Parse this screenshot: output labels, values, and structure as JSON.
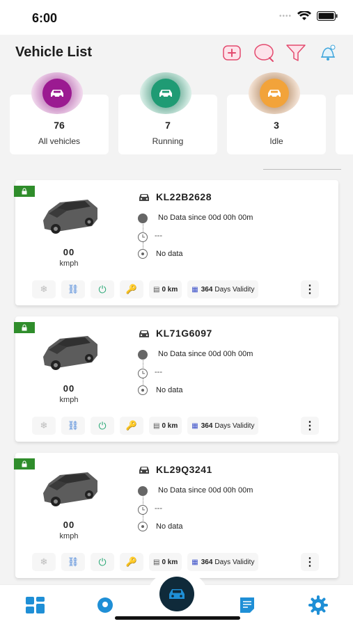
{
  "status": {
    "time": "6:00"
  },
  "header": {
    "title": "Vehicle List",
    "icons": [
      "add-icon",
      "search-icon",
      "filter-icon",
      "notification-bell-icon"
    ]
  },
  "summary": [
    {
      "count": "76",
      "label": "All vehicles",
      "color": "#9b1a91"
    },
    {
      "count": "7",
      "label": "Running",
      "color": "#1f9b74"
    },
    {
      "count": "3",
      "label": "Idle",
      "color": "#f2a33a"
    }
  ],
  "vehicles": [
    {
      "plate": "KL22B2628",
      "status_text": "No Data since  00d 00h 00m",
      "time_text": "---",
      "location_text": "No data",
      "speed": "00",
      "speed_unit": "kmph",
      "odometer": "0 km",
      "validity_days": "364",
      "validity_label": "Days Validity"
    },
    {
      "plate": "KL71G6097",
      "status_text": "No Data since  00d 00h 00m",
      "time_text": "---",
      "location_text": "No data",
      "speed": "00",
      "speed_unit": "kmph",
      "odometer": "0 km",
      "validity_days": "364",
      "validity_label": "Days Validity"
    },
    {
      "plate": "KL29Q3241",
      "status_text": "No Data since  00d 00h 00m",
      "time_text": "---",
      "location_text": "No data",
      "speed": "00",
      "speed_unit": "kmph",
      "odometer": "0 km",
      "validity_days": "364",
      "validity_label": "Days Validity"
    }
  ],
  "bottom_nav": {
    "items": [
      "dashboard-icon",
      "location-icon",
      "vehicle-icon",
      "report-icon",
      "settings-icon"
    ],
    "accent": "#1f8fd6"
  }
}
